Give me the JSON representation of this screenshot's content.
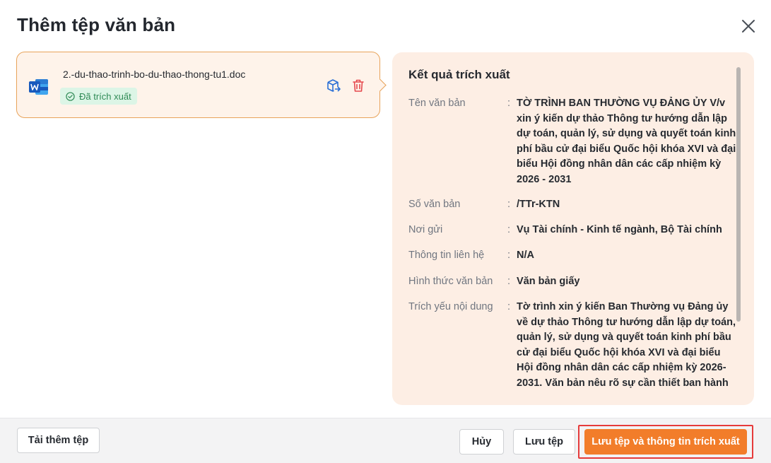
{
  "dialog": {
    "title": "Thêm tệp văn bản",
    "close_icon": "close-icon"
  },
  "file": {
    "icon": "word-document-icon",
    "name": "2.-du-thao-trinh-bo-du-thao-thong-tu1.doc",
    "status": "Đã trích xuất",
    "status_icon": "check-circle-icon",
    "actions": [
      "move-to-box-icon",
      "delete-icon"
    ]
  },
  "result": {
    "title": "Kết quả trích xuất",
    "separator": ":",
    "fields": [
      {
        "label": "Tên văn bản",
        "value": "TỜ TRÌNH BAN THƯỜNG VỤ ĐẢNG ỦY V/v xin ý kiến dự thảo Thông tư hướng dẫn lập dự toán, quản lý, sử dụng và quyết toán kinh phí bầu cử đại biểu Quốc hội khóa XVI và đại biểu Hội đồng nhân dân các cấp nhiệm kỳ 2026 - 2031"
      },
      {
        "label": "Số văn bản",
        "value": "/TTr-KTN"
      },
      {
        "label": "Nơi gửi",
        "value": "Vụ Tài chính - Kinh tế ngành, Bộ Tài chính"
      },
      {
        "label": "Thông tin liên hệ",
        "value": "N/A"
      },
      {
        "label": "Hình thức văn bản",
        "value": "Văn bản giấy"
      },
      {
        "label": "Trích yếu nội dung",
        "value": "Tờ trình xin ý kiến Ban Thường vụ Đảng ủy về dự thảo Thông tư hướng dẫn lập dự toán, quản lý, sử dụng và quyết toán kinh phí bầu cử đại biểu Quốc hội khóa XVI và đại biểu Hội đồng nhân dân các cấp nhiệm kỳ 2026-2031. Văn bản nêu rõ sự cần thiết ban hành"
      }
    ]
  },
  "footer": {
    "upload_more": "Tải thêm tệp",
    "cancel": "Hủy",
    "save_file": "Lưu tệp",
    "save_with_info": "Lưu tệp và thông tin trích xuất"
  },
  "colors": {
    "accent": "#f27d2a",
    "panel_bg": "#fdeee4",
    "status_green": "#2f8a55",
    "delete_red": "#e5484d",
    "word_blue": "#185abd"
  }
}
